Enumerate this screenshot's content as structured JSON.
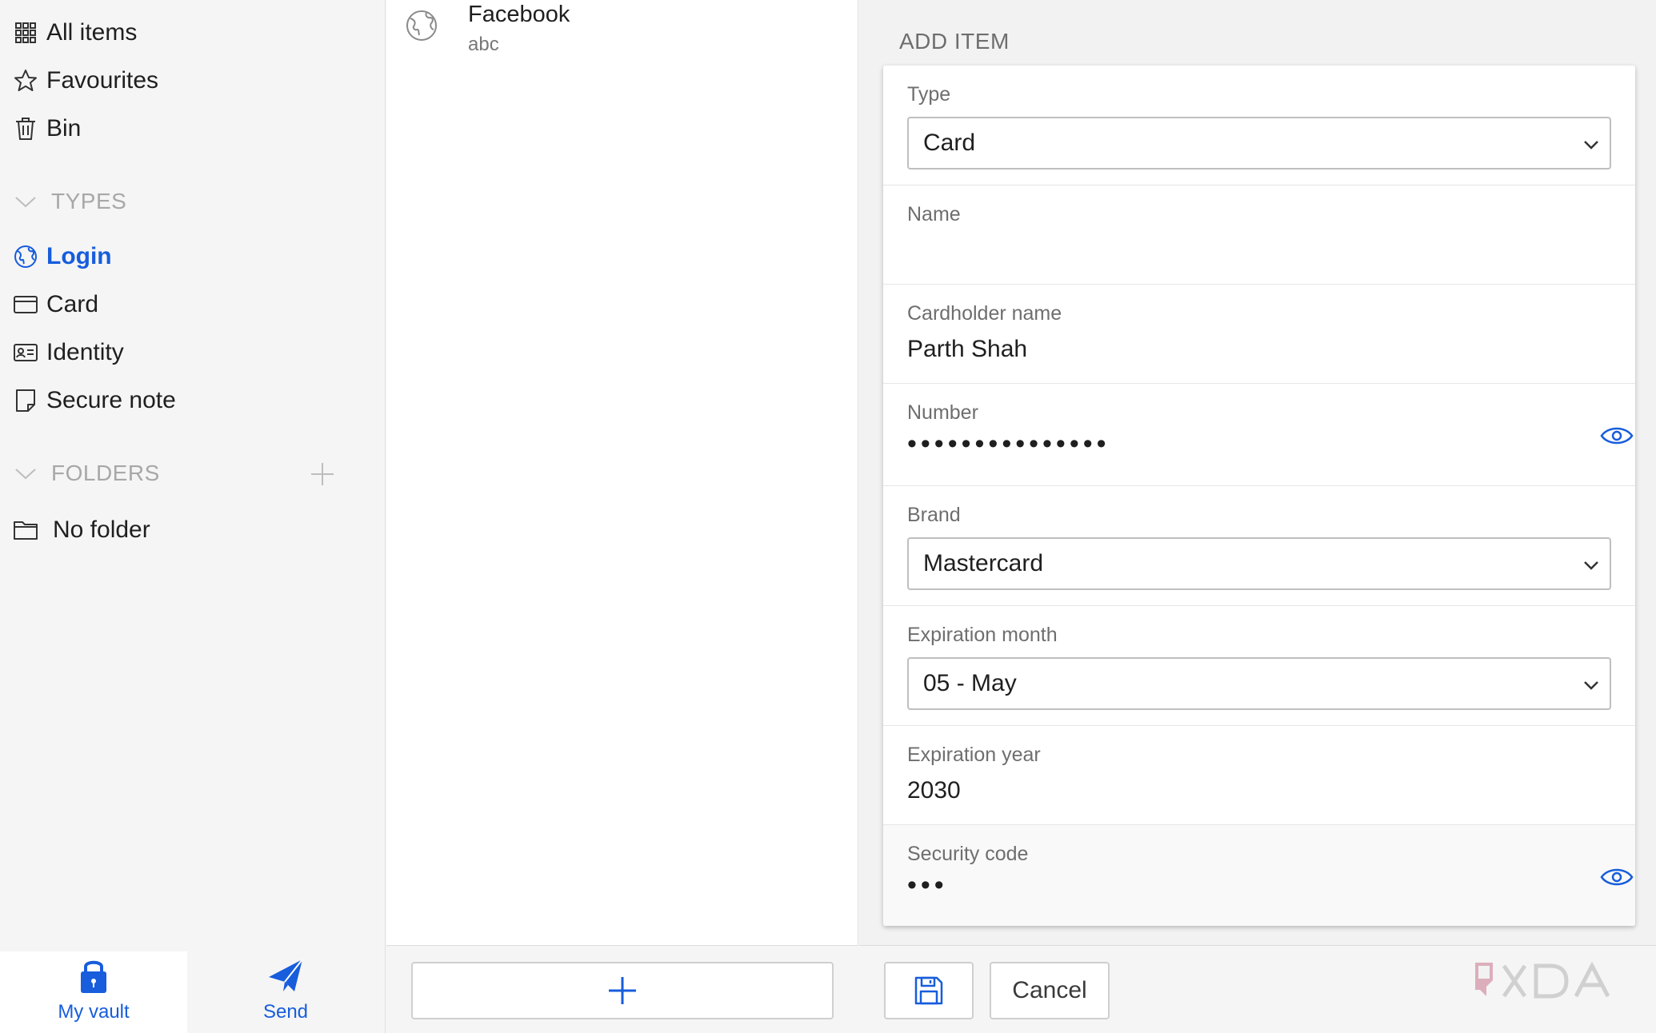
{
  "sidebar": {
    "items": [
      {
        "label": "All items",
        "icon": "grid-icon"
      },
      {
        "label": "Favourites",
        "icon": "star-icon"
      },
      {
        "label": "Bin",
        "icon": "trash-icon"
      }
    ],
    "types_header": "TYPES",
    "types": [
      {
        "label": "Login",
        "icon": "globe-icon",
        "active": true
      },
      {
        "label": "Card",
        "icon": "credit-card-icon"
      },
      {
        "label": "Identity",
        "icon": "id-card-icon"
      },
      {
        "label": "Secure note",
        "icon": "note-icon"
      }
    ],
    "folders_header": "FOLDERS",
    "folders": [
      {
        "label": "No folder",
        "icon": "folder-icon"
      }
    ],
    "bottom_tabs": [
      {
        "label": "My vault",
        "icon": "lock-icon",
        "active": true
      },
      {
        "label": "Send",
        "icon": "paper-plane-icon"
      }
    ]
  },
  "list": {
    "items": [
      {
        "title": "Facebook",
        "subtitle": "abc",
        "icon": "globe-icon"
      }
    ]
  },
  "detail": {
    "title": "ADD ITEM",
    "fields": {
      "type": {
        "label": "Type",
        "value": "Card"
      },
      "name": {
        "label": "Name",
        "value": ""
      },
      "cardholder": {
        "label": "Cardholder name",
        "value": "Parth Shah"
      },
      "number": {
        "label": "Number",
        "value": "•••••••••••••••"
      },
      "brand": {
        "label": "Brand",
        "value": "Mastercard"
      },
      "exp_month": {
        "label": "Expiration month",
        "value": "05 - May"
      },
      "exp_year": {
        "label": "Expiration year",
        "value": "2030"
      },
      "security_code": {
        "label": "Security code",
        "value": "•••"
      }
    },
    "footer": {
      "cancel_label": "Cancel"
    }
  },
  "watermark": {
    "text": "XDA"
  },
  "colors": {
    "accent": "#175ddc",
    "muted": "#a8a8a8",
    "label": "#6e6e6e"
  }
}
